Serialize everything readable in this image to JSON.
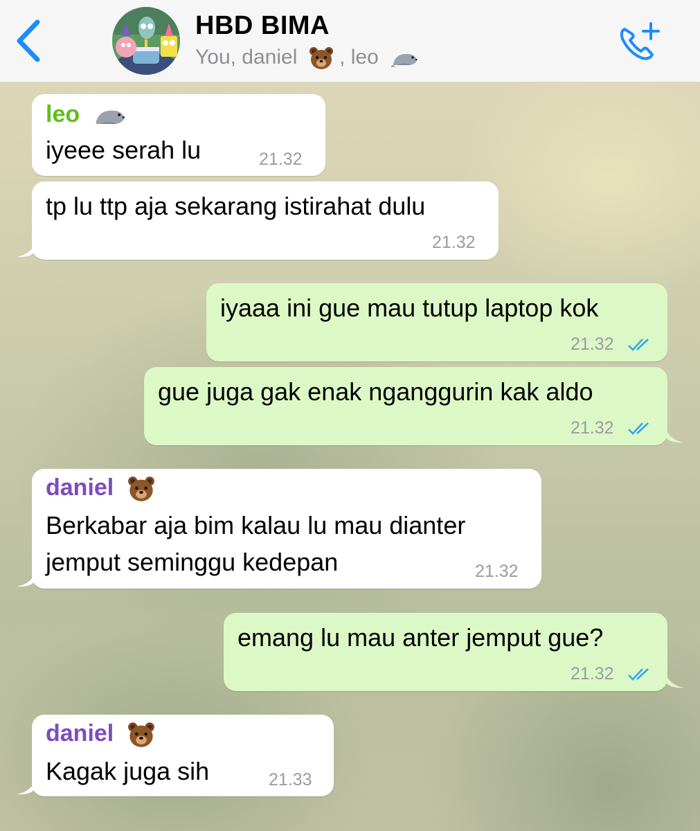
{
  "header": {
    "title": "HBD BIMA",
    "subtitle_prefix": "You, daniel",
    "subtitle_mid": ", leo",
    "accent_color": "#1a8cff"
  },
  "messages": [
    {
      "direction": "in",
      "sender": "leo",
      "sender_color": "#5fbf1a",
      "sender_emoji": "seal",
      "text": "iyeee serah lu",
      "time": "21.32"
    },
    {
      "direction": "in",
      "text": "tp lu ttp aja sekarang istirahat dulu",
      "time": "21.32"
    },
    {
      "direction": "out",
      "text": "iyaaa ini gue mau tutup laptop kok",
      "time": "21.32",
      "status": "read"
    },
    {
      "direction": "out",
      "text": "gue juga gak enak nganggurin kak aldo",
      "time": "21.32",
      "status": "read"
    },
    {
      "direction": "in",
      "sender": "daniel",
      "sender_color": "#7e4bbf",
      "sender_emoji": "bear",
      "text_line1": "Berkabar aja bim kalau lu mau dianter",
      "text_line2": "jemput seminggu kedepan",
      "time": "21.32"
    },
    {
      "direction": "out",
      "text": "emang lu mau anter jemput gue?",
      "time": "21.32",
      "status": "read"
    },
    {
      "direction": "in",
      "sender": "daniel",
      "sender_color": "#7e4bbf",
      "sender_emoji": "bear",
      "text": "Kagak juga sih",
      "time": "21.33"
    }
  ]
}
